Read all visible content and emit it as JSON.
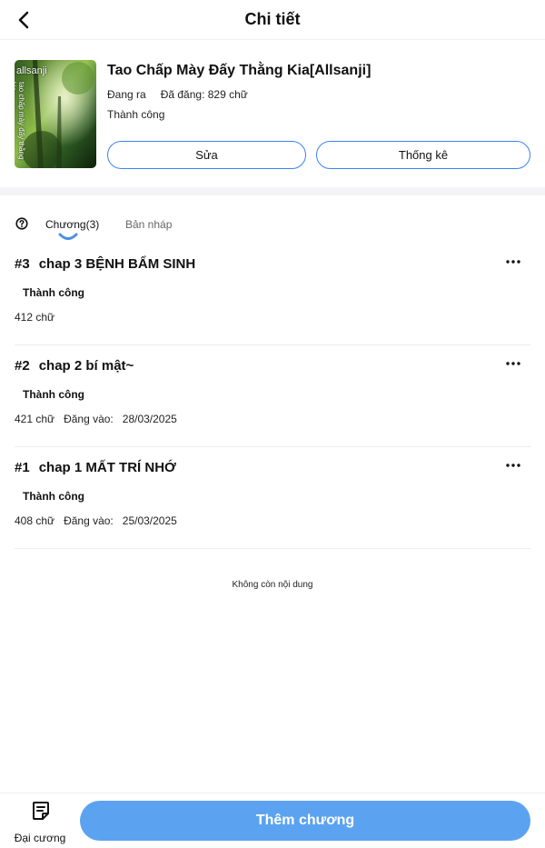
{
  "header": {
    "title": "Chi tiết"
  },
  "book": {
    "cover_text": "allsanji",
    "cover_side_text": "tao chấp mày đấy thằng kia",
    "title": "Tao Chấp Mày Đấy Thằng Kia[Allsanji]",
    "state": "Đang ra",
    "posted": "Đã đăng: 829 chữ",
    "status": "Thành công",
    "edit_label": "Sửa",
    "stats_label": "Thống kê"
  },
  "tabs": {
    "chapters": "Chương(3)",
    "drafts": "Bản nháp"
  },
  "chapters": [
    {
      "number": "#3",
      "title": "chap 3 BỆNH BẨM SINH",
      "status": "Thành công",
      "words": "412 chữ",
      "date_label": "",
      "date": ""
    },
    {
      "number": "#2",
      "title": "chap 2 bí mật~",
      "status": "Thành công",
      "words": "421 chữ",
      "date_label": "Đăng vào:",
      "date": "28/03/2025"
    },
    {
      "number": "#1",
      "title": "chap 1 MẤT TRÍ NHỚ",
      "status": "Thành công",
      "words": "408 chữ",
      "date_label": "Đăng vào:",
      "date": "25/03/2025"
    }
  ],
  "end_note": "Không còn nội dung",
  "bottom": {
    "outline_label": "Đại cương",
    "add_chapter_label": "Thêm chương"
  },
  "colors": {
    "accent": "#5ba3f0",
    "outline": "#3b82f6",
    "band": "#f4f4f6"
  },
  "icons": [
    "back-arrow-icon",
    "help-icon",
    "more-icon",
    "outline-doc-icon"
  ]
}
